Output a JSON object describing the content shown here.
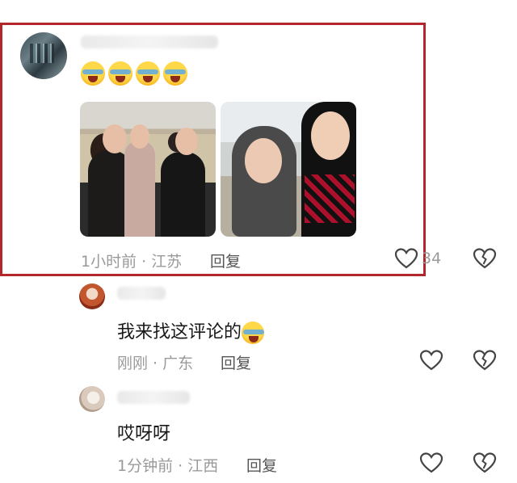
{
  "comments": [
    {
      "emoji_count": 4,
      "emoji": "face-with-tears-of-joy",
      "photos": [
        "family-photo-left",
        "family-photo-right"
      ],
      "time": "1小时前",
      "location": "江苏",
      "reply_label": "回复",
      "like_count": "34"
    },
    {
      "text": "我来找这评论的",
      "time": "刚刚",
      "location": "广东",
      "reply_label": "回复"
    },
    {
      "text": "哎呀呀",
      "time": "1分钟前",
      "location": "江西",
      "reply_label": "回复"
    }
  ],
  "separator": " · ",
  "colors": {
    "highlight_border": "#b3262a",
    "meta_text": "#9a9a9a"
  }
}
